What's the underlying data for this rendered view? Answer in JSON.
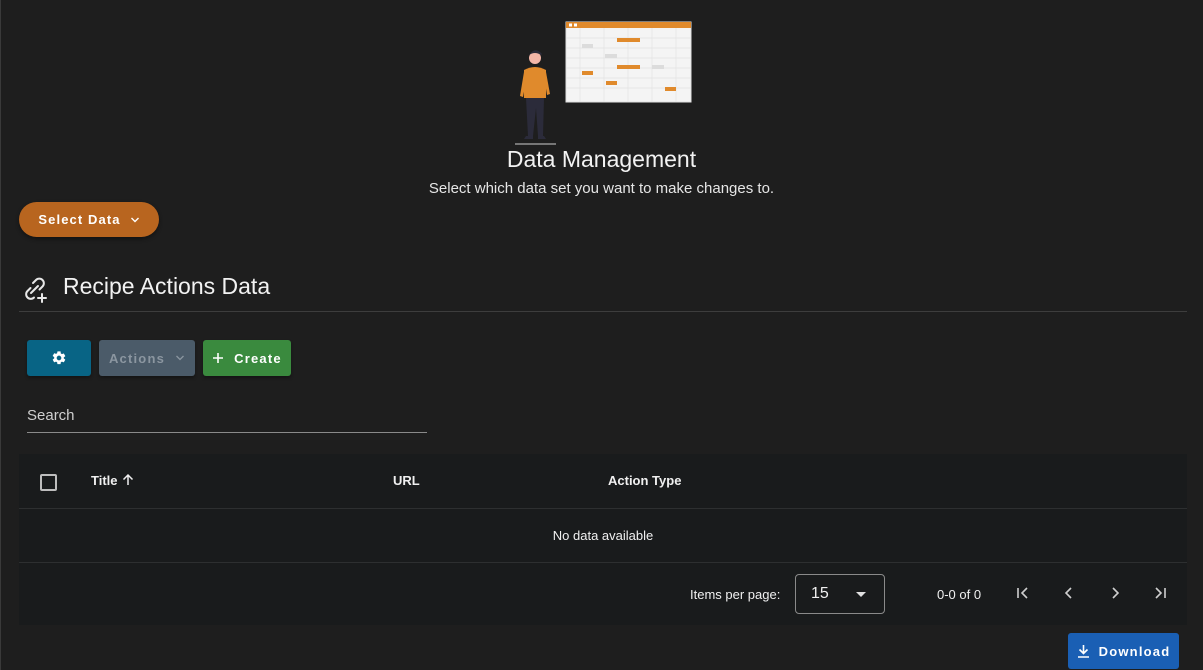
{
  "hero": {
    "title": "Data Management",
    "subtitle": "Select which data set you want to make changes to."
  },
  "select_data": {
    "label": "Select Data"
  },
  "section": {
    "title": "Recipe Actions Data"
  },
  "toolbar": {
    "actions_label": "Actions",
    "create_label": "Create"
  },
  "search": {
    "label": "Search"
  },
  "table": {
    "columns": [
      "Title",
      "URL",
      "Action Type"
    ],
    "empty_text": "No data available"
  },
  "footer": {
    "items_per_page_label": "Items per page:",
    "items_per_page_value": "15",
    "range_text": "0-0 of 0"
  },
  "download": {
    "label": "Download"
  },
  "colors": {
    "background": "#1e1e1e",
    "select_data": "#b8651f",
    "settings_button": "#086485",
    "actions_button": "#4b5b69",
    "create_button": "#3a8a3e",
    "download_button": "#1a5fb4",
    "illustration_accent": "#e08a2c"
  },
  "icons": [
    "chevron-down-icon",
    "link-plus-icon",
    "gear-icon",
    "plus-icon",
    "sort-ascending-icon",
    "caret-down-icon",
    "first-page-icon",
    "prev-page-icon",
    "next-page-icon",
    "last-page-icon",
    "download-icon"
  ]
}
